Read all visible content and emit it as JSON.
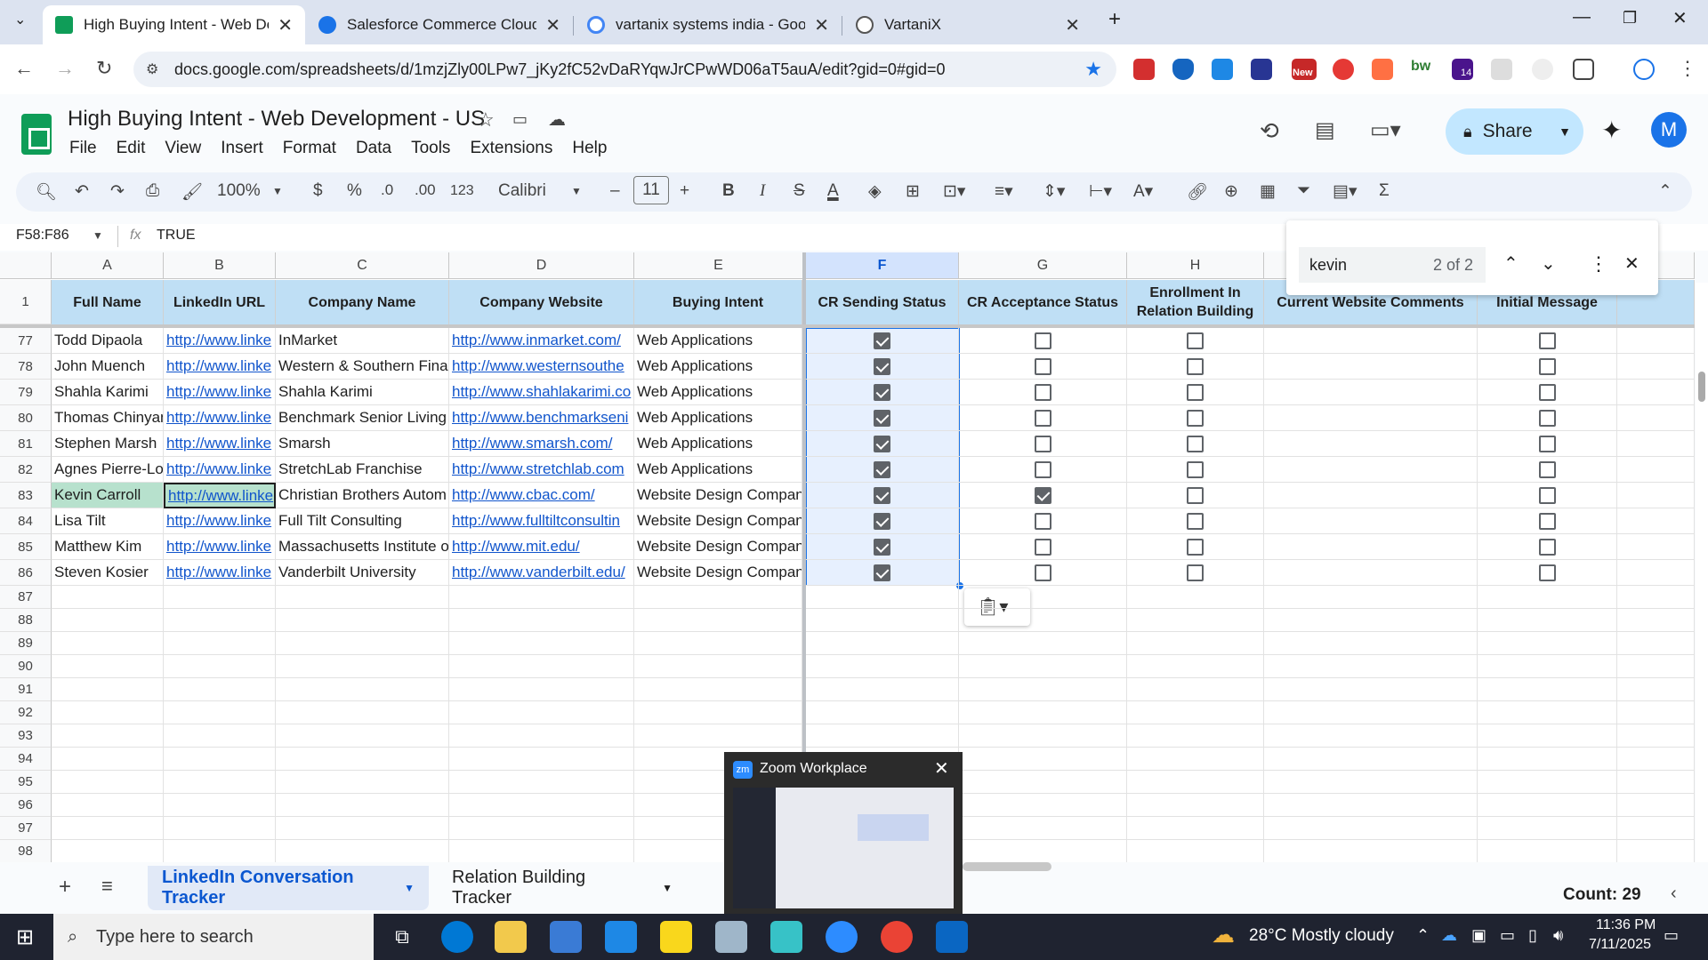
{
  "browser": {
    "tabs": [
      {
        "title": "High Buying Intent - Web Deve",
        "color": "#0f9d58"
      },
      {
        "title": "Salesforce Commerce Cloud Su",
        "color": "#1a73e8"
      },
      {
        "title": "vartanix systems india - Google",
        "color": "#4285f4"
      },
      {
        "title": "VartaniX",
        "color": "#555"
      }
    ],
    "url": "docs.google.com/spreadsheets/d/1mzjZly00LPw7_jKy2fC52vDaRYqwJrCPwWD06aT5auA/edit?gid=0#gid=0",
    "ext_badges": {
      "new": "New",
      "count": "14"
    }
  },
  "doc": {
    "title": "High Buying Intent - Web Development - US",
    "menus": [
      "File",
      "Edit",
      "View",
      "Insert",
      "Format",
      "Data",
      "Tools",
      "Extensions",
      "Help"
    ],
    "share": "Share",
    "avatar": "M"
  },
  "toolbar": {
    "zoom": "100%",
    "currency": "$",
    "percent": "%",
    "dec_down": ".0",
    "dec_up": ".00",
    "numfmt": "123",
    "font": "Calibri",
    "font_size": "11",
    "bold": "B",
    "italic": "I",
    "strike": "S"
  },
  "formula": {
    "cellref": "F58:F86",
    "fx": "fx",
    "value": "TRUE"
  },
  "find": {
    "query": "kevin",
    "count": "2 of 2"
  },
  "columns": [
    "A",
    "B",
    "C",
    "D",
    "E",
    "F",
    "G",
    "H"
  ],
  "headers": {
    "a": "Full Name",
    "b": "LinkedIn URL",
    "c": "Company Name",
    "d": "Company Website",
    "e": "Buying Intent",
    "f": "CR Sending Status",
    "g": "CR Acceptance Status",
    "h": "Enrollment In Relation Building",
    "i": "Current Website Comments",
    "j": "Initial Message"
  },
  "rows": [
    {
      "n": "77",
      "name": "Todd Dipaola",
      "url": "http://www.linke",
      "company": "InMarket",
      "website": "http://www.inmarket.com/",
      "intent": "Web Applications",
      "f": true,
      "g": false
    },
    {
      "n": "78",
      "name": "John Muench",
      "url": "http://www.linke",
      "company": "Western & Southern Finan",
      "website": "http://www.westernsouthe",
      "intent": "Web Applications",
      "f": true,
      "g": false
    },
    {
      "n": "79",
      "name": "Shahla Karimi",
      "url": "http://www.linke",
      "company": "Shahla Karimi",
      "website": "http://www.shahlakarimi.co",
      "intent": "Web Applications",
      "f": true,
      "g": false
    },
    {
      "n": "80",
      "name": "Thomas Chinyan",
      "url": "http://www.linke",
      "company": "Benchmark Senior Living",
      "website": "http://www.benchmarkseni",
      "intent": "Web Applications",
      "f": true,
      "g": false
    },
    {
      "n": "81",
      "name": "Stephen Marsh",
      "url": "http://www.linke",
      "company": "Smarsh",
      "website": "http://www.smarsh.com/",
      "intent": "Web Applications",
      "f": true,
      "g": false
    },
    {
      "n": "82",
      "name": "Agnes Pierre-Lou",
      "url": "http://www.linke",
      "company": "StretchLab Franchise",
      "website": "http://www.stretchlab.com",
      "intent": "Web Applications",
      "f": true,
      "g": false
    },
    {
      "n": "83",
      "name": "Kevin Carroll",
      "url": "http://www.linke",
      "company": "Christian Brothers Autom",
      "website": "http://www.cbac.com/",
      "intent": "Website Design Compani",
      "f": true,
      "g": true
    },
    {
      "n": "84",
      "name": "Lisa Tilt",
      "url": "http://www.linke",
      "company": "Full Tilt Consulting",
      "website": "http://www.fulltiltconsultin",
      "intent": "Website Design Compani",
      "f": true,
      "g": false
    },
    {
      "n": "85",
      "name": "Matthew Kim",
      "url": "http://www.linke",
      "company": "Massachusetts Institute o",
      "website": "http://www.mit.edu/",
      "intent": "Website Design Compani",
      "f": true,
      "g": false
    },
    {
      "n": "86",
      "name": "Steven Kosier",
      "url": "http://www.linke",
      "company": "Vanderbilt University",
      "website": "http://www.vanderbilt.edu/",
      "intent": "Website Design Compani",
      "f": true,
      "g": false
    }
  ],
  "empty_rows": [
    "87",
    "88",
    "89",
    "90",
    "91",
    "92",
    "93",
    "94",
    "95",
    "96",
    "97",
    "98"
  ],
  "sheets": {
    "active": "LinkedIn Conversation Tracker",
    "other": "Relation Building Tracker",
    "count": "Count: 29"
  },
  "zoom_popup": {
    "title": "Zoom Workplace"
  },
  "taskbar": {
    "search": "Type here to search",
    "weather": "28°C  Mostly cloudy",
    "time": "11:36 PM",
    "date": "7/11/2025"
  }
}
